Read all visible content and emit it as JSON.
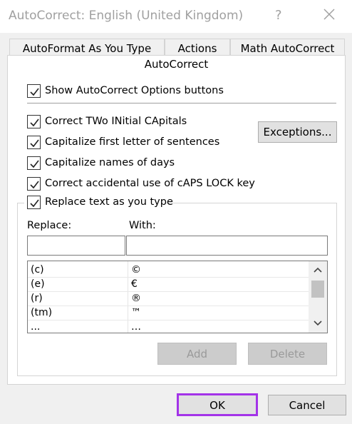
{
  "window": {
    "title": "AutoCorrect: English (United Kingdom)",
    "help": "?"
  },
  "tabs": [
    {
      "label": "AutoFormat As You Type"
    },
    {
      "label": "Actions"
    },
    {
      "label": "Math AutoCorrect"
    },
    {
      "label": "AutoCorrect"
    }
  ],
  "options": {
    "show_buttons": "Show AutoCorrect Options buttons",
    "two_initial": "Correct TWo INitial CApitals",
    "first_letter": "Capitalize first letter of sentences",
    "names_days": "Capitalize names of days",
    "caps_lock": "Correct accidental use of cAPS LOCK key",
    "replace_text": "Replace text as you type"
  },
  "exceptions_label": "Exceptions...",
  "replace": {
    "replace_label": "Replace:",
    "with_label": "With:",
    "replace_value": "",
    "with_value": ""
  },
  "entries": [
    {
      "replace": "(c)",
      "with": "©"
    },
    {
      "replace": "(e)",
      "with": "€"
    },
    {
      "replace": "(r)",
      "with": "®"
    },
    {
      "replace": "(tm)",
      "with": "™"
    },
    {
      "replace": "...",
      "with": "…"
    }
  ],
  "buttons": {
    "add": "Add",
    "delete": "Delete",
    "ok": "OK",
    "cancel": "Cancel"
  },
  "colors": {
    "highlight": "#a333e8"
  }
}
